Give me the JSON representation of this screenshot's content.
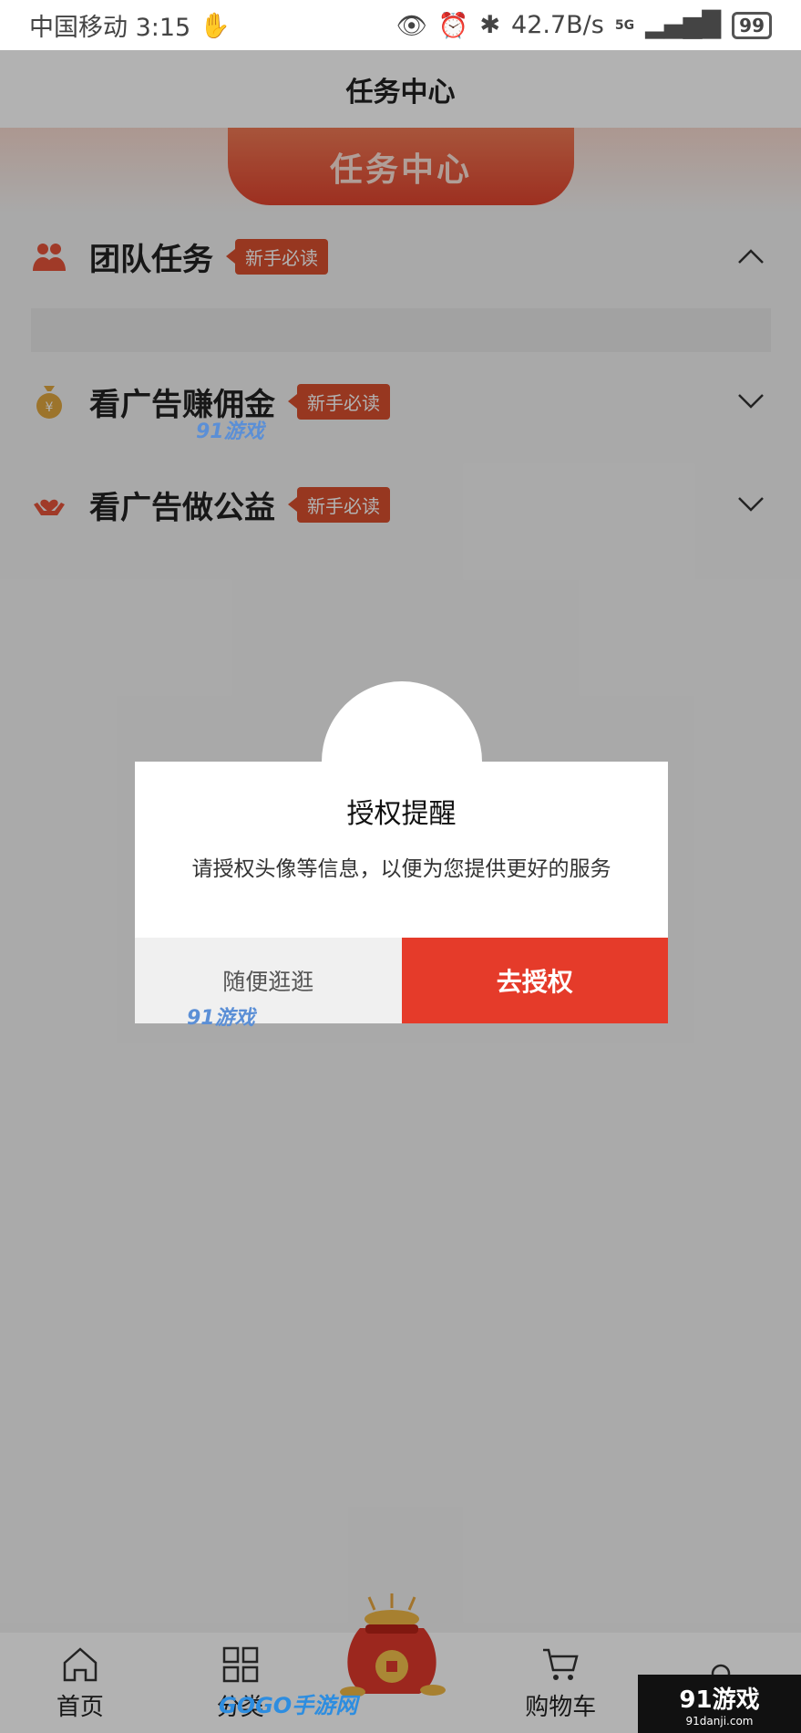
{
  "status_bar": {
    "carrier_time": "中国移动 3:15",
    "net_speed": "42.7B/s",
    "network_type": "5G",
    "battery": "99"
  },
  "header": {
    "title": "任务中心"
  },
  "banner": {
    "label": "任务中心"
  },
  "tasks": [
    {
      "title": "团队任务",
      "badge": "新手必读",
      "icon": "team-icon",
      "expanded": true
    },
    {
      "title": "看广告赚佣金",
      "badge": "新手必读",
      "icon": "money-bag-icon",
      "expanded": false
    },
    {
      "title": "看广告做公益",
      "badge": "新手必读",
      "icon": "charity-hands-icon",
      "expanded": false
    }
  ],
  "dialog": {
    "title": "授权提醒",
    "message": "请授权头像等信息，以便为您提供更好的服务",
    "secondary_button": "随便逛逛",
    "primary_button": "去授权"
  },
  "tabbar": {
    "items": [
      {
        "label": "首页",
        "icon": "home-icon"
      },
      {
        "label": "分类",
        "icon": "grid-icon"
      },
      {
        "label": "",
        "icon": "red-bag-icon"
      },
      {
        "label": "购物车",
        "icon": "cart-icon"
      },
      {
        "label": "",
        "icon": "profile-icon"
      }
    ]
  },
  "watermarks": {
    "logo_91": "91游戏",
    "site_91": "91danji.com",
    "gogo": "GOGO手游网"
  },
  "colors": {
    "accent": "#e53b2a",
    "badge": "#d8502e",
    "banner": "#e1442f"
  }
}
